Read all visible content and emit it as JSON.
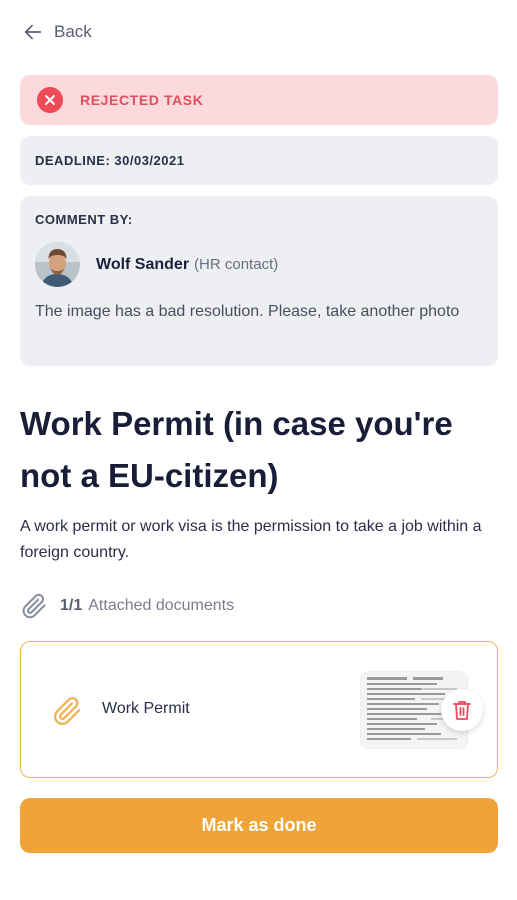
{
  "header": {
    "back_label": "Back"
  },
  "status": {
    "label": "REJECTED TASK",
    "color": "#ee4a57",
    "background": "#fbd9dc"
  },
  "deadline": {
    "text": "DEADLINE: 30/03/2021"
  },
  "comment": {
    "heading": "COMMENT BY:",
    "author_name": "Wolf Sander",
    "author_role": "(HR contact)",
    "text": "The image has a bad resolution. Please, take another photo"
  },
  "task": {
    "title": "Work Permit (in case you're not a EU-citizen)",
    "description": "A work permit or work visa is the permission to take a job within a foreign country."
  },
  "attachments": {
    "count": "1/1",
    "label": "Attached documents",
    "items": [
      {
        "name": "Work Permit"
      }
    ]
  },
  "actions": {
    "primary_label": "Mark as done",
    "primary_color": "#eea438"
  },
  "icons": [
    "arrow-left-icon",
    "close-icon",
    "paperclip-icon",
    "trash-icon"
  ]
}
